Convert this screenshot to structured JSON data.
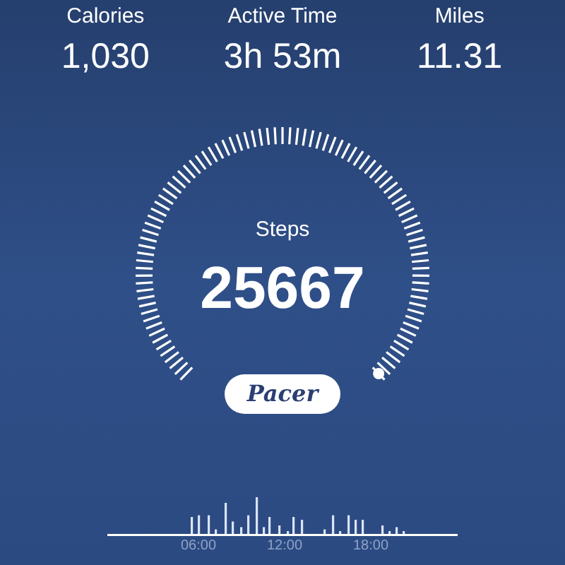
{
  "stats": [
    {
      "label": "Calories",
      "value": "1,030"
    },
    {
      "label": "Active Time",
      "value": "3h 53m"
    },
    {
      "label": "Miles",
      "value": "11.31"
    }
  ],
  "steps": {
    "label": "Steps",
    "value": "25667"
  },
  "logo": "Pacer",
  "activity": {
    "time_labels": [
      "06:00",
      "12:00",
      "18:00"
    ]
  }
}
